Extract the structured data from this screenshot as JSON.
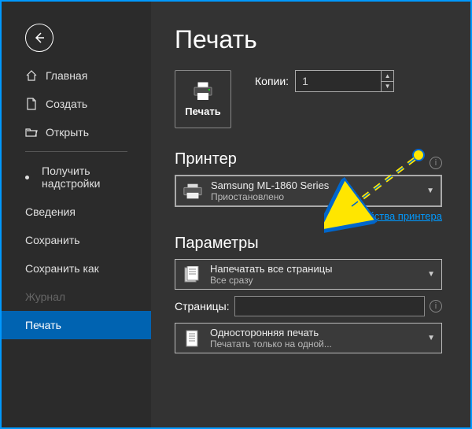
{
  "sidebar": {
    "items": [
      {
        "label": "Главная"
      },
      {
        "label": "Создать"
      },
      {
        "label": "Открыть"
      },
      {
        "label": "Получить надстройки"
      },
      {
        "label": "Сведения"
      },
      {
        "label": "Сохранить"
      },
      {
        "label": "Сохранить как"
      },
      {
        "label": "Журнал"
      },
      {
        "label": "Печать"
      }
    ]
  },
  "main": {
    "title": "Печать",
    "print_button": "Печать",
    "copies_label": "Копии:",
    "copies_value": "1",
    "printer_section": "Принтер",
    "printer_name": "Samsung ML-1860 Series",
    "printer_status": "Приостановлено",
    "printer_props_link": "Свойства принтера",
    "params_section": "Параметры",
    "scope_primary": "Напечатать все страницы",
    "scope_secondary": "Все сразу",
    "pages_label": "Страницы:",
    "pages_value": "",
    "duplex_primary": "Односторонняя печать",
    "duplex_secondary": "Печатать только на одной..."
  }
}
